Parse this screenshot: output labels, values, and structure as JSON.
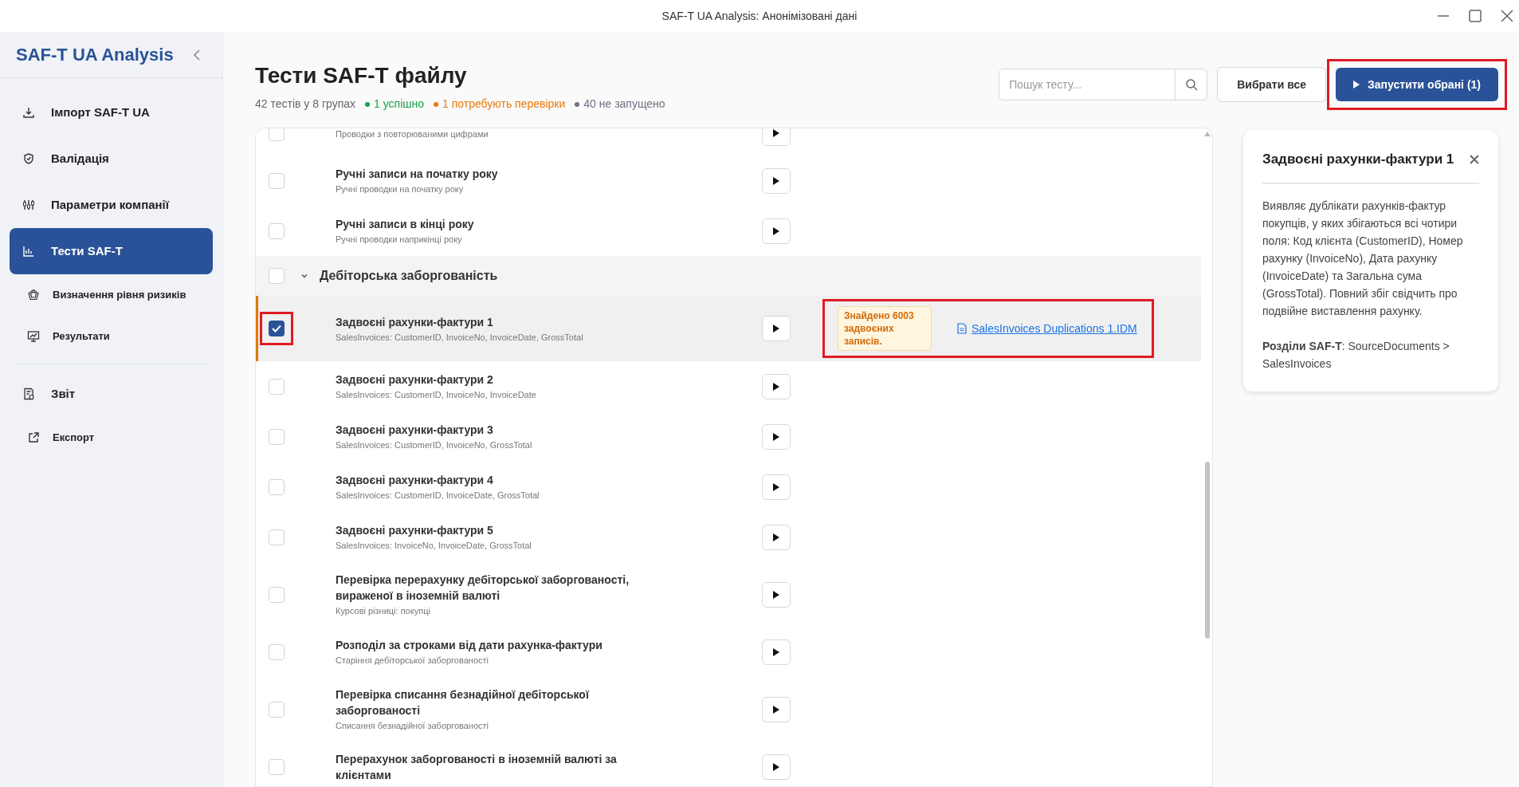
{
  "window": {
    "title": "SAF-T UA Analysis: Анонімізовані дані"
  },
  "sidebar": {
    "logo": "SAF-T UA Analysis",
    "groups": [
      [
        {
          "label": "Імпорт SAF-T UA",
          "kind": "main",
          "selected": false
        },
        {
          "label": "Валідація",
          "kind": "main",
          "selected": false
        },
        {
          "label": "Параметри компанії",
          "kind": "main",
          "selected": false
        },
        {
          "label": "Тести SAF-T",
          "kind": "main",
          "selected": true
        },
        {
          "label": "Визначення рівня ризиків",
          "kind": "sub",
          "selected": false
        },
        {
          "label": "Результати",
          "kind": "sub",
          "selected": false
        }
      ],
      [
        {
          "label": "Звіт",
          "kind": "main",
          "selected": false
        },
        {
          "label": "Експорт",
          "kind": "sub",
          "selected": false
        }
      ]
    ]
  },
  "header": {
    "title": "Тести SAF-T файлу",
    "summary": "42 тестів у 8 групах",
    "stats": [
      {
        "text": "1 успішно",
        "color": "#16a34a"
      },
      {
        "text": "1 потребують перевірки",
        "color": "#ea7a0c"
      },
      {
        "text": "40 не запущено",
        "color": "#6b7280"
      }
    ],
    "search": {
      "placeholder": "Пошук тесту..."
    },
    "select_all": "Вибрати все",
    "run_button": {
      "label": "Запустити обрані (1)",
      "highlighted": true
    }
  },
  "rows": [
    {
      "kind": "test",
      "subtitle": "Проводки з повторюваними цифрами",
      "checked": false,
      "selected": false
    },
    {
      "kind": "test",
      "title": "Ручні записи на початку року",
      "subtitle": "Ручні проводки на початку року",
      "checked": false,
      "selected": false
    },
    {
      "kind": "test",
      "title": "Ручні записи в кінці року",
      "subtitle": "Ручні проводки наприкінці року",
      "checked": false,
      "selected": false
    },
    {
      "kind": "group",
      "label": "Дебіторська заборгованість",
      "checked": false,
      "expanded": true
    },
    {
      "kind": "test",
      "title": "Задвоєні рахунки-фактури 1",
      "subtitle": "SalesInvoices: CustomerID, InvoiceNo, InvoiceDate, GrossTotal",
      "checked": true,
      "selected": true,
      "highlighted": true,
      "result": {
        "badge": "Знайдено 6003 задвоєних записів.",
        "link": "SalesInvoices Duplications 1.IDM",
        "highlighted": true
      }
    },
    {
      "kind": "test",
      "title": "Задвоєні рахунки-фактури 2",
      "subtitle": "SalesInvoices: CustomerID, InvoiceNo, InvoiceDate",
      "checked": false,
      "selected": false
    },
    {
      "kind": "test",
      "title": "Задвоєні рахунки-фактури 3",
      "subtitle": "SalesInvoices: CustomerID, InvoiceNo, GrossTotal",
      "checked": false,
      "selected": false
    },
    {
      "kind": "test",
      "title": "Задвоєні рахунки-фактури 4",
      "subtitle": "SalesInvoices: CustomerID, InvoiceDate, GrossTotal",
      "checked": false,
      "selected": false
    },
    {
      "kind": "test",
      "title": "Задвоєні рахунки-фактури 5",
      "subtitle": "SalesInvoices: InvoiceNo, InvoiceDate, GrossTotal",
      "checked": false,
      "selected": false
    },
    {
      "kind": "test",
      "title": "Перевірка перерахунку дебіторської заборгованості, вираженої в іноземній валюті",
      "subtitle": "Курсові різниці: покупці",
      "checked": false,
      "selected": false
    },
    {
      "kind": "test",
      "title": "Розподіл за строками від дати рахунка-фактури",
      "subtitle": "Старіння дебіторської заборгованості",
      "checked": false,
      "selected": false
    },
    {
      "kind": "test",
      "title": "Перевірка списання безнадійної дебіторської заборгованості",
      "subtitle": "Списання безнадійної заборгованості",
      "checked": false,
      "selected": false
    },
    {
      "kind": "test",
      "title": "Перерахунок заборгованості в іноземній валюті за клієнтами",
      "checked": false,
      "selected": false
    }
  ],
  "detail": {
    "title": "Задвоєні рахунки-фактури 1",
    "description": "Виявляє дублікати рахунків-фактур покупців, у яких збігаються всі чотири поля: Код клієнта (CustomerID), Номер рахунку (InvoiceNo), Дата рахунку (InvoiceDate) та Загальна сума (GrossTotal). Повний збіг свідчить про подвійне виставлення рахунку.",
    "sections": "**Розділи SAF-T**: SourceDocuments > SalesInvoices"
  }
}
